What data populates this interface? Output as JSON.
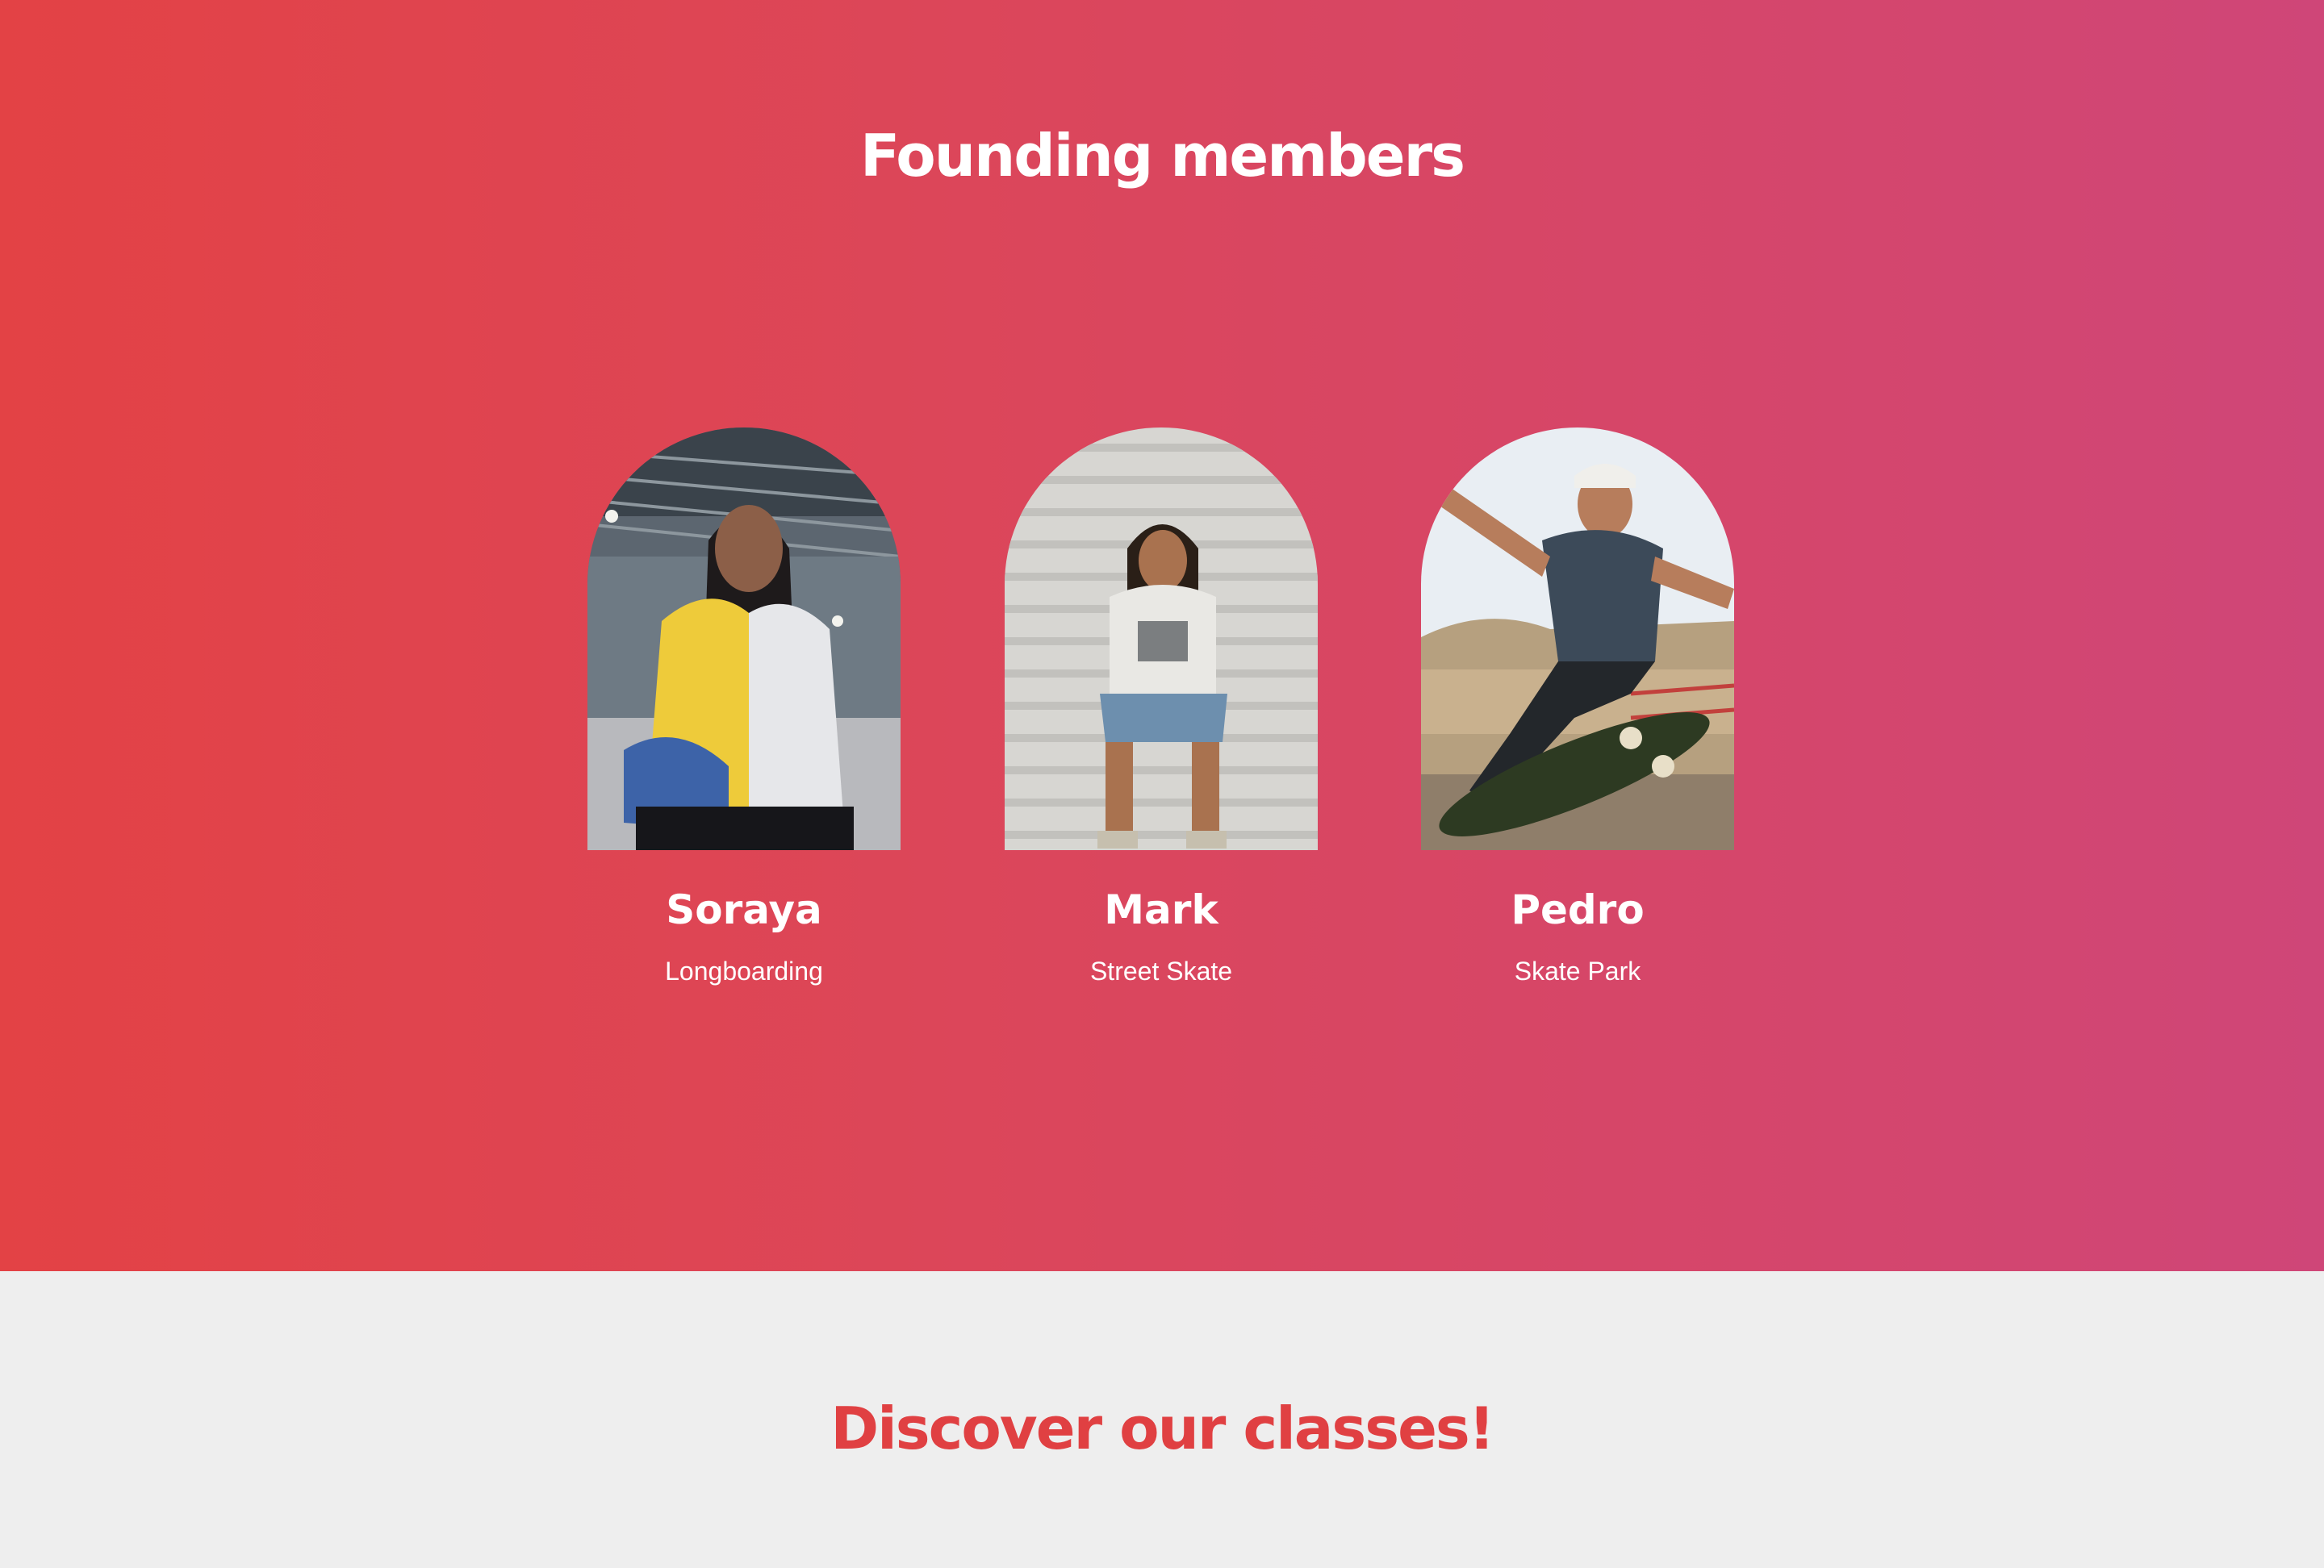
{
  "members_section": {
    "title": "Founding members",
    "gradient": [
      "#e34245",
      "#cf4678"
    ],
    "members": [
      {
        "name": "Soraya",
        "discipline": "Longboarding",
        "photo": "woman-in-yellow-windbreaker-photo"
      },
      {
        "name": "Mark",
        "discipline": "Street Skate",
        "photo": "man-sitting-on-stairs-photo"
      },
      {
        "name": "Pedro",
        "discipline": "Skate Park",
        "photo": "skateboarder-doing-trick-photo"
      }
    ]
  },
  "classes_section": {
    "title": "Discover our classes!",
    "title_color": "#e04042",
    "background": "#eeeeee"
  }
}
